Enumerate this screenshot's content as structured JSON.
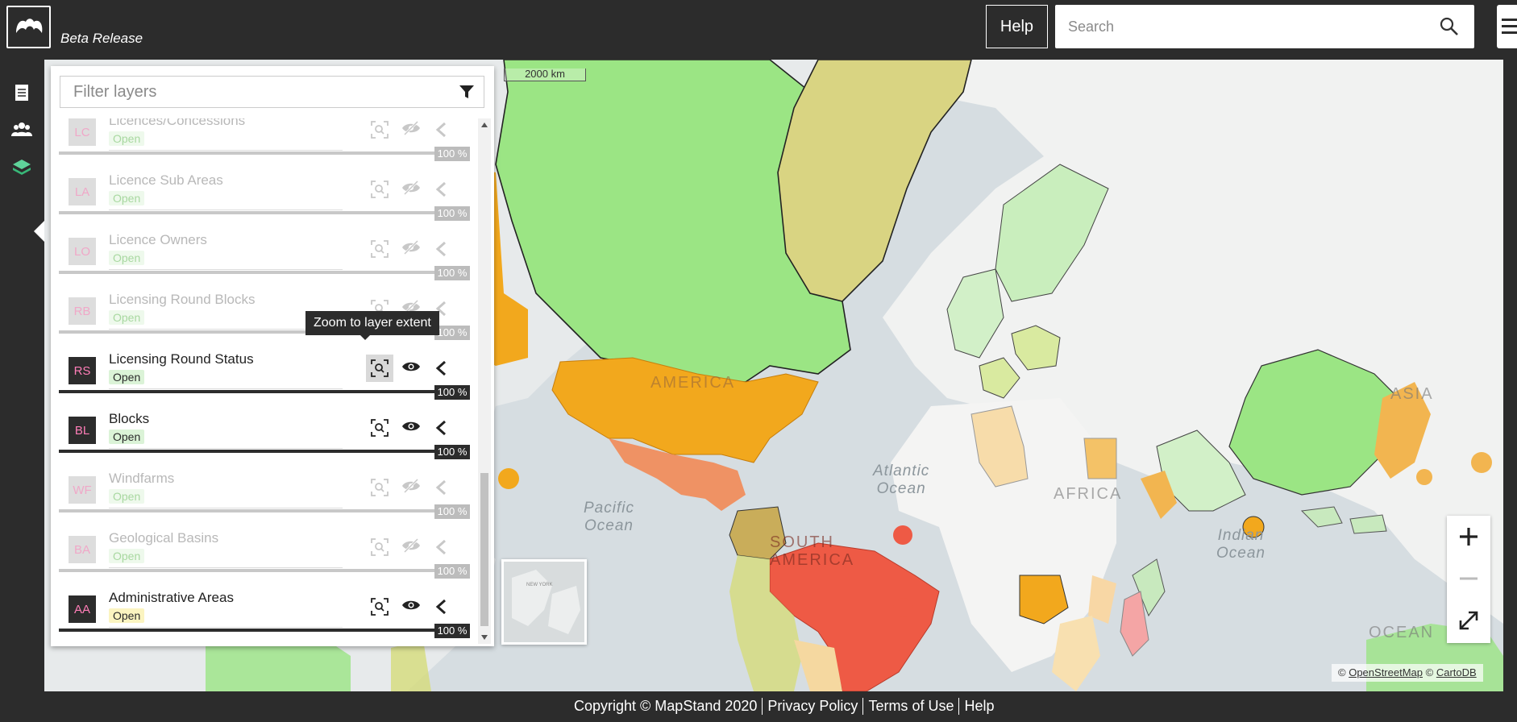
{
  "header": {
    "beta_label": "Beta Release",
    "help_label": "Help",
    "search_placeholder": "Search"
  },
  "map": {
    "scale_label": "2000 km",
    "labels": {
      "america": "AMERICA",
      "atlantic": "Atlantic\nOcean",
      "pacific": "Pacific\nOcean",
      "south_america": "SOUTH\nAMERICA",
      "africa": "AFRICA",
      "asia": "ASIA",
      "indian": "Indian\nOcean",
      "oceania": "OCEAN"
    },
    "minimap_label": "NEW YORK",
    "attribution": {
      "prefix": "©",
      "osm": "OpenStreetMap",
      "cartodb": "CartoDB"
    }
  },
  "panel": {
    "filter_placeholder": "Filter layers",
    "tooltip": "Zoom to layer extent",
    "layers": [
      {
        "code": "LC",
        "name": "Licences/Concessions",
        "status": "Open",
        "opacity": "100 %",
        "visible": false
      },
      {
        "code": "LA",
        "name": "Licence Sub Areas",
        "status": "Open",
        "opacity": "100 %",
        "visible": false
      },
      {
        "code": "LO",
        "name": "Licence Owners",
        "status": "Open",
        "opacity": "100 %",
        "visible": false
      },
      {
        "code": "RB",
        "name": "Licensing Round Blocks",
        "status": "Open",
        "opacity": "100 %",
        "visible": false
      },
      {
        "code": "RS",
        "name": "Licensing Round Status",
        "status": "Open",
        "opacity": "100 %",
        "visible": true
      },
      {
        "code": "BL",
        "name": "Blocks",
        "status": "Open",
        "opacity": "100 %",
        "visible": true
      },
      {
        "code": "WF",
        "name": "Windfarms",
        "status": "Open",
        "opacity": "100 %",
        "visible": false
      },
      {
        "code": "BA",
        "name": "Geological Basins",
        "status": "Open",
        "opacity": "100 %",
        "visible": false
      },
      {
        "code": "AA",
        "name": "Administrative Areas",
        "status": "Open",
        "opacity": "100 %",
        "visible": true
      }
    ]
  },
  "footer": {
    "copyright": "Copyright © MapStand 2020",
    "privacy": "Privacy Policy",
    "terms": "Terms of Use",
    "help": "Help"
  },
  "colors": {
    "chrome": "#2c2c2c",
    "green_region": "#9be584",
    "orange_region": "#f2a81d",
    "red_region": "#ee5a45",
    "khaki_region": "#d9d482"
  }
}
